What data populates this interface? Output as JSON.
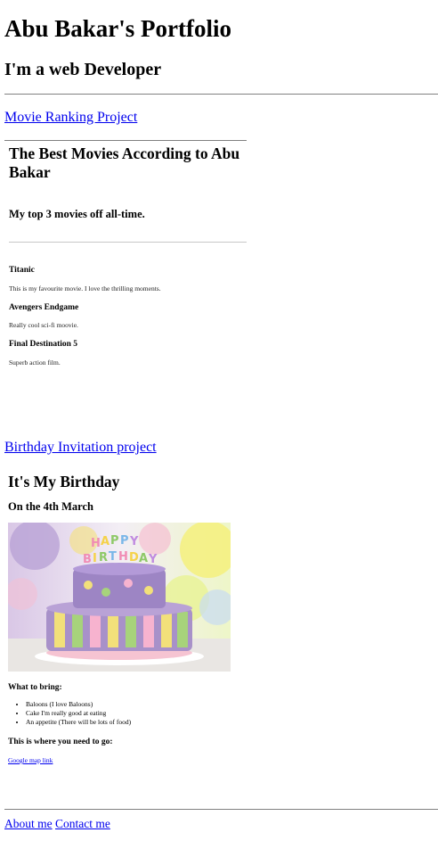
{
  "header": {
    "title": "Abu Bakar's Portfolio",
    "subtitle": "I'm a web Developer"
  },
  "projects": {
    "movie_link": "Movie Ranking Project",
    "birthday_link": "Birthday Invitation project"
  },
  "movie_page": {
    "title": "The Best Movies According to Abu Bakar",
    "subtitle": "My top 3 movies off all-time.",
    "movies": [
      {
        "title": "Titanic",
        "description": "This is my favourite movie. I love the thrilling moments."
      },
      {
        "title": "Avengers Endgame",
        "description": "Really cool sci-fi moovie."
      },
      {
        "title": "Final Destination 5",
        "description": "Superb action film."
      }
    ]
  },
  "birthday_page": {
    "title": "It's My Birthday",
    "date": "On the 4th March",
    "image_alt": "HAPPY BIRTHDAY",
    "bring_title": "What to bring:",
    "bring_items": [
      "Baloons (I love Baloons)",
      "Cake I'm really good at eating",
      "An appetite (There will be lots of food)"
    ],
    "location_title": "This is where you need to go:",
    "map_link": "Google map link"
  },
  "footer": {
    "about_link": "About me",
    "contact_link": "Contact me"
  },
  "colors": {
    "link": "#0000ee",
    "rule": "#808080"
  }
}
